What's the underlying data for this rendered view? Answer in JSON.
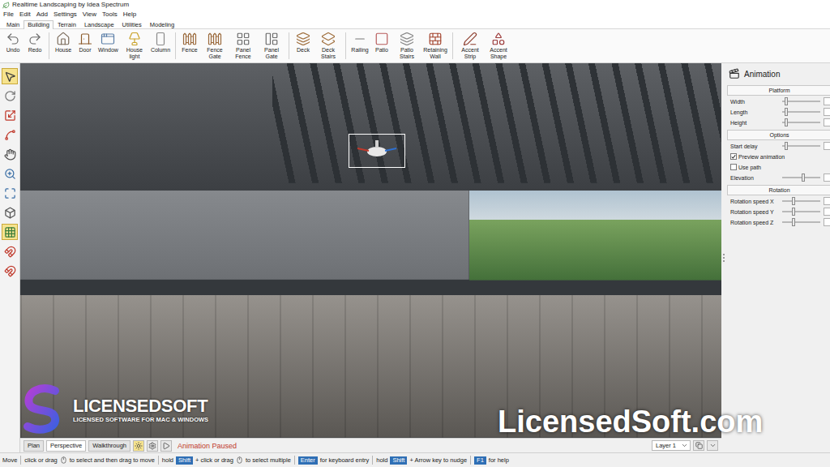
{
  "window": {
    "title": "Realtime Landscaping by Idea Spectrum"
  },
  "menu": [
    "File",
    "Edit",
    "Add",
    "Settings",
    "View",
    "Tools",
    "Help"
  ],
  "tabs": [
    {
      "label": "Main",
      "selected": false
    },
    {
      "label": "Building",
      "selected": true
    },
    {
      "label": "Terrain",
      "selected": false
    },
    {
      "label": "Landscape",
      "selected": false
    },
    {
      "label": "Utilities",
      "selected": false
    },
    {
      "label": "Modeling",
      "selected": false
    }
  ],
  "ribbon": {
    "groups": [
      {
        "buttons": [
          "Undo",
          "Redo"
        ]
      },
      {
        "buttons": [
          "House",
          "Door",
          "Window",
          "House light",
          "Column"
        ]
      },
      {
        "buttons": [
          "Fence",
          "Fence Gate",
          "Panel Fence",
          "Panel Gate"
        ]
      },
      {
        "buttons": [
          "Deck",
          "Deck Stairs"
        ]
      },
      {
        "buttons": [
          "Railing",
          "Patio",
          "Patio Stairs",
          "Retaining Wall"
        ]
      },
      {
        "buttons": [
          "Accent Strip",
          "Accent Shape"
        ]
      }
    ]
  },
  "tools": [
    {
      "selected": true
    },
    {
      "selected": false
    },
    {
      "selected": false
    },
    {
      "selected": false
    },
    {
      "selected": false
    },
    {
      "selected": false
    },
    {
      "selected": false
    },
    {
      "selected": false
    },
    {
      "selected": true
    },
    {
      "selected": false
    },
    {
      "selected": false
    }
  ],
  "viewport": {
    "tabs": [
      {
        "label": "Plan",
        "selected": false
      },
      {
        "label": "Perspective",
        "selected": true
      },
      {
        "label": "Walkthrough",
        "selected": false
      }
    ],
    "controls": [
      {
        "selected": true
      },
      {
        "selected": false
      },
      {
        "selected": false
      }
    ],
    "status": "Animation Paused",
    "layer": "Layer 1"
  },
  "panel": {
    "title": "Animation",
    "sections": [
      {
        "title": "Platform",
        "rows": [
          {
            "kind": "slider",
            "label": "Width",
            "level": 0.1
          },
          {
            "kind": "slider",
            "label": "Length",
            "level": 0.1
          },
          {
            "kind": "slider",
            "label": "Height",
            "level": 0.1
          }
        ]
      },
      {
        "title": "Options",
        "rows": [
          {
            "kind": "slider",
            "label": "Start delay",
            "level": 0.1
          },
          {
            "kind": "checkbox",
            "label": "Preview animation",
            "checked": true
          },
          {
            "kind": "checkbox",
            "label": "Use path",
            "checked": false
          },
          {
            "kind": "slider",
            "label": "Elevation",
            "level": 0.55
          }
        ]
      },
      {
        "title": "Rotation",
        "rows": [
          {
            "kind": "slider",
            "label": "Rotation speed X",
            "level": 0.3
          },
          {
            "kind": "slider",
            "label": "Rotation speed Y",
            "level": 0.3
          },
          {
            "kind": "slider",
            "label": "Rotation speed Z",
            "level": 0.3
          }
        ]
      }
    ]
  },
  "status_bar": {
    "segments": [
      [
        {
          "kind": "text",
          "text": "Move"
        }
      ],
      [
        {
          "kind": "text",
          "text": "click or drag"
        },
        {
          "kind": "icon"
        },
        {
          "kind": "text",
          "text": "to select and then drag to move"
        }
      ],
      [
        {
          "kind": "text",
          "text": "hold"
        },
        {
          "kind": "key",
          "text": "Shift"
        },
        {
          "kind": "text",
          "text": "+ click or drag"
        },
        {
          "kind": "icon"
        },
        {
          "kind": "text",
          "text": "to select multiple"
        }
      ],
      [
        {
          "kind": "key",
          "text": "Enter"
        },
        {
          "kind": "text",
          "text": "for keyboard entry"
        }
      ],
      [
        {
          "kind": "text",
          "text": "hold"
        },
        {
          "kind": "key",
          "text": "Shift"
        },
        {
          "kind": "text",
          "text": "+ Arrow key to nudge"
        }
      ],
      [
        {
          "kind": "key",
          "text": "F1"
        },
        {
          "kind": "text",
          "text": "for help"
        }
      ]
    ]
  },
  "watermark": {
    "brand": "LICENSEDSOFT",
    "tagline": "LICENSED SOFTWARE FOR MAC & WINDOWS",
    "url": "LicensedSoft.com"
  }
}
